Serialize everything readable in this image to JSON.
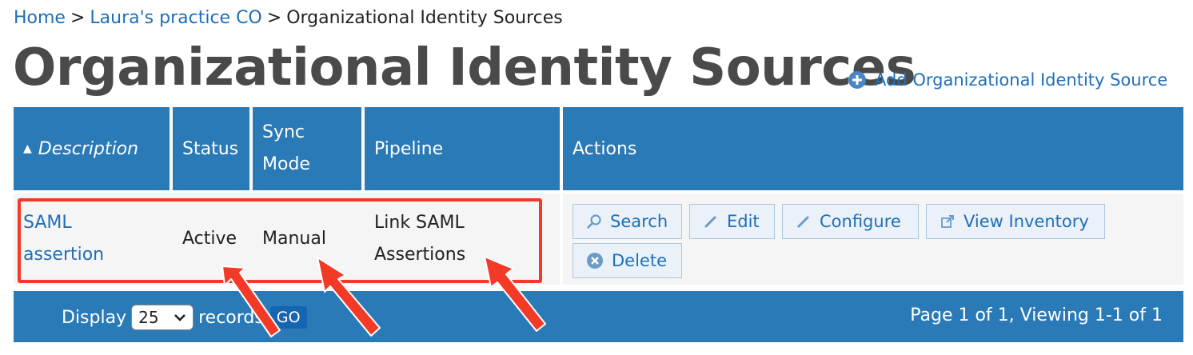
{
  "breadcrumb": {
    "home": "Home",
    "co": "Laura's practice CO",
    "current": "Organizational Identity Sources",
    "separator": ">"
  },
  "page_title": "Organizational Identity Sources",
  "add_link": {
    "label": "Add Organizational Identity Source",
    "icon": "plus-circle-icon"
  },
  "table": {
    "headers": {
      "description": "Description",
      "status": "Status",
      "sync_mode_line1": "Sync",
      "sync_mode_line2": "Mode",
      "pipeline": "Pipeline",
      "actions": "Actions"
    },
    "sort_indicator": "▲",
    "rows": [
      {
        "description_line1": "SAML",
        "description_line2": "assertion",
        "status": "Active",
        "sync_mode": "Manual",
        "pipeline_line1": "Link SAML",
        "pipeline_line2": "Assertions",
        "actions": {
          "search": "Search",
          "edit": "Edit",
          "configure": "Configure",
          "view_inventory": "View Inventory",
          "delete": "Delete"
        }
      }
    ]
  },
  "footer": {
    "display_label": "Display",
    "records_value": "25",
    "records_label": "records",
    "go_label": "GO",
    "page_info": "Page 1 of 1, Viewing 1-1 of 1"
  },
  "colors": {
    "header_blue": "#2a7ab7",
    "link_blue": "#1f6fb8",
    "annotation_red": "#f23a27"
  }
}
